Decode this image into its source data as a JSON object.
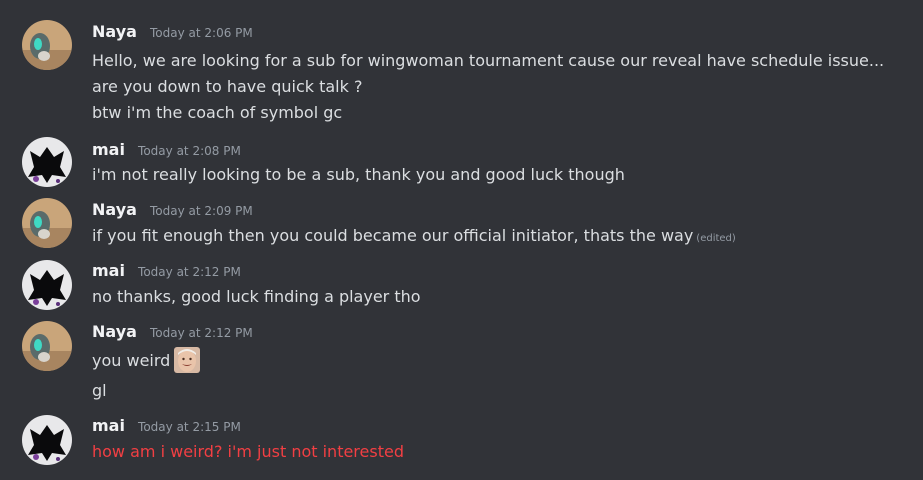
{
  "messages": [
    {
      "author": "Naya",
      "timestamp": "Today at 2:06 PM",
      "lines": [
        "Hello, we are looking for a sub for wingwoman tournament cause our reveal have schedule issue...",
        "are you down to have quick talk ?",
        "btw i'm the coach of symbol gc"
      ]
    },
    {
      "author": "mai",
      "timestamp": "Today at 2:08 PM",
      "lines": [
        "i'm not really looking to be a sub, thank you and good luck though"
      ]
    },
    {
      "author": "Naya",
      "timestamp": "Today at 2:09 PM",
      "lines": [
        "if you fit enough then you could became our official initiator, thats the way"
      ],
      "edited_label": "(edited)"
    },
    {
      "author": "mai",
      "timestamp": "Today at 2:12 PM",
      "lines": [
        "no thanks, good luck finding a player tho"
      ]
    },
    {
      "author": "Naya",
      "timestamp": "Today at 2:12 PM",
      "lines": [
        "you weird",
        "gl"
      ],
      "emoji": "smiling-face-emoji"
    },
    {
      "author": "mai",
      "timestamp": "Today at 2:15 PM",
      "lines": [
        "how am i weird? i'm just not interested"
      ],
      "line_color": "#f23f43"
    }
  ],
  "colors": {
    "background": "#313338",
    "author": "#f2f3f5",
    "text": "#dbdee1",
    "timestamp": "#949ba4",
    "highlight_red": "#f23f43"
  }
}
